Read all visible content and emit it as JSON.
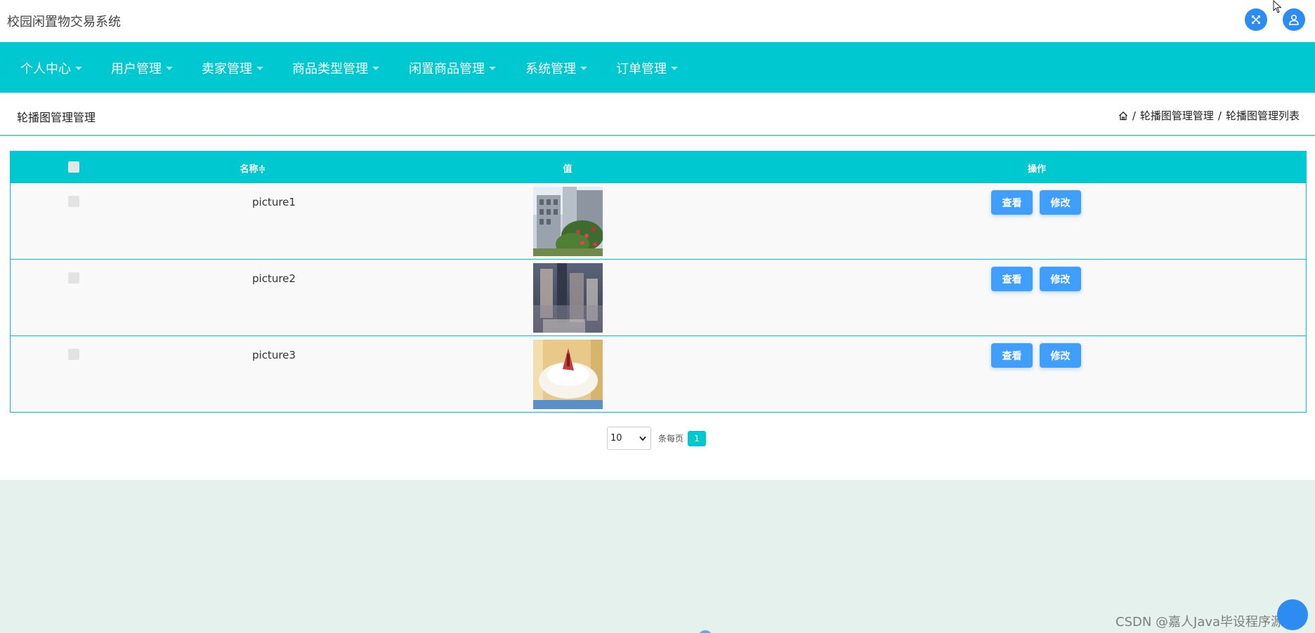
{
  "app": {
    "title": "校园闲置物交易系统",
    "accent": "#00c8d0",
    "button_color": "#409eff",
    "icons": {
      "fullscreen": "expand-arrows-icon",
      "user": "user-icon"
    }
  },
  "nav": {
    "items": [
      {
        "label": "个人中心"
      },
      {
        "label": "用户管理"
      },
      {
        "label": "卖家管理"
      },
      {
        "label": "商品类型管理"
      },
      {
        "label": "闲置商品管理"
      },
      {
        "label": "系统管理"
      },
      {
        "label": "订单管理"
      }
    ]
  },
  "page": {
    "title": "轮播图管理管理",
    "breadcrumb": [
      "轮播图管理管理",
      "轮播图管理列表"
    ],
    "breadcrumb_sep": "/"
  },
  "table": {
    "columns": {
      "name": "名称",
      "sort_icon": "≑",
      "value": "值",
      "actions": "操作"
    },
    "rows": [
      {
        "name": "picture1",
        "image": "building-photo"
      },
      {
        "name": "picture2",
        "image": "blurred-bottles-photo"
      },
      {
        "name": "picture3",
        "image": "cake-photo"
      }
    ],
    "view_label": "查看",
    "edit_label": "修改"
  },
  "pagination": {
    "page_size": "10",
    "per_page_label": "条每页",
    "current_page": "1"
  },
  "watermark": "CSDN @嘉人Java毕设程序源码"
}
